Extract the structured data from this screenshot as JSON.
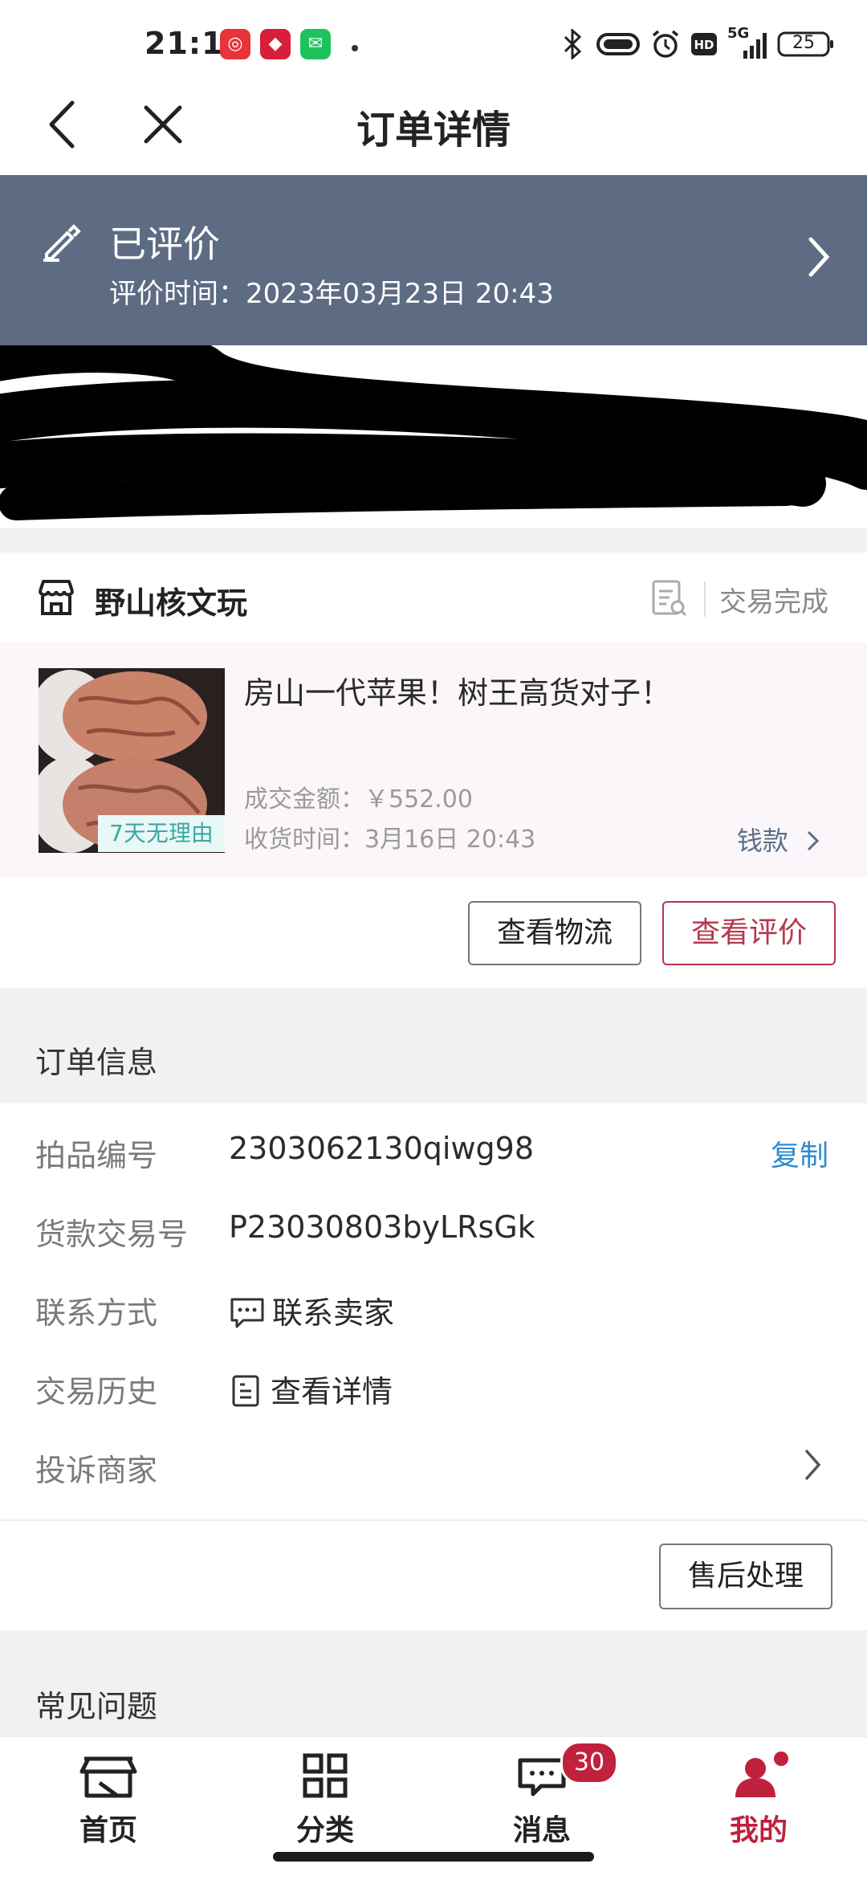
{
  "status_bar": {
    "time": "21:13",
    "network": "5G",
    "battery": "25"
  },
  "nav": {
    "title": "订单详情"
  },
  "banner": {
    "title": "已评价",
    "time": "评价时间：2023年03月23日 20:43"
  },
  "shop": {
    "name": "野山核文玩",
    "status": "交易完成"
  },
  "product": {
    "title": "房山一代苹果！树王高货对子！",
    "tag": "7天无理由",
    "price": "成交金额：￥552.00",
    "receive_time": "收货时间：3月16日 20:43",
    "refund_link": "钱款"
  },
  "actions": {
    "logistics": "查看物流",
    "review": "查看评价"
  },
  "order_info": {
    "title": "订单信息",
    "rows": [
      {
        "label": "拍品编号",
        "value": "2303062130qiwg98",
        "action": "复制"
      },
      {
        "label": "货款交易号",
        "value": "P23030803byLRsGk"
      },
      {
        "label": "联系方式",
        "value": "联系卖家"
      },
      {
        "label": "交易历史",
        "value": "查看详情"
      },
      {
        "label": "投诉商家"
      }
    ],
    "after_sale": "售后处理"
  },
  "faq": {
    "title": "常见问题"
  },
  "tabs": {
    "items": [
      {
        "label": "首页"
      },
      {
        "label": "分类"
      },
      {
        "label": "消息",
        "badge": "30"
      },
      {
        "label": "我的"
      }
    ],
    "active_color": "#c0213c"
  },
  "colors": {
    "banner": "#5d6b83",
    "accent": "#b5374d",
    "link": "#2f8bcf"
  }
}
